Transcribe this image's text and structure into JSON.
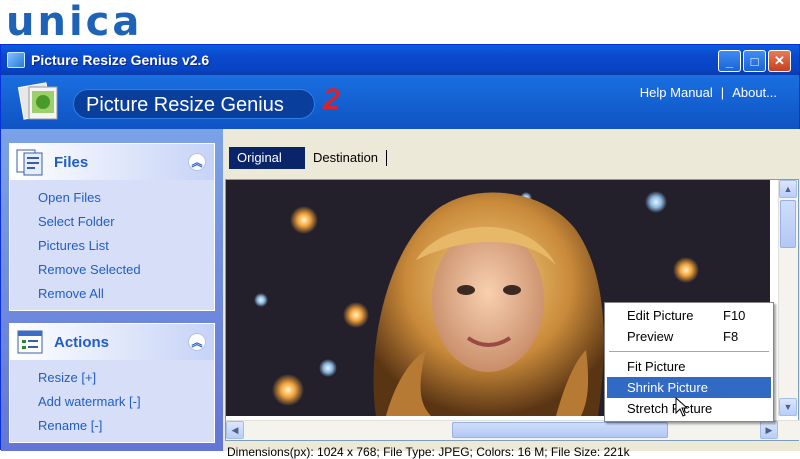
{
  "brand": "unica",
  "window": {
    "title": "Picture Resize Genius  v2.6",
    "buttons": {
      "minimize": "_",
      "maximize": "□",
      "close": "✕"
    }
  },
  "header": {
    "logo_text": "Picture Resize Genius",
    "logo_version": "2",
    "help_link": "Help Manual",
    "separator": "|",
    "about_link": "About..."
  },
  "sidebar": {
    "files": {
      "title": "Files",
      "items": [
        "Open Files",
        "Select Folder",
        "Pictures List",
        "Remove Selected",
        "Remove All"
      ]
    },
    "actions": {
      "title": "Actions",
      "items": [
        "Resize [+]",
        "Add watermark [-]",
        "Rename [-]"
      ]
    }
  },
  "tabs": {
    "original": "Original",
    "destination": "Destination"
  },
  "context_menu": {
    "edit_picture": {
      "label": "Edit Picture",
      "shortcut": "F10"
    },
    "preview": {
      "label": "Preview",
      "shortcut": "F8"
    },
    "fit_picture": "Fit Picture",
    "shrink_picture": "Shrink Picture",
    "stretch_picture": "Stretch Picture"
  },
  "status_text": "Dimensions(px): 1024 x 768; File Type: JPEG; Colors: 16 M; File Size: 221k",
  "colors": {
    "accent": "#215dc6",
    "title_bar": "#0a48cc",
    "highlight": "#316ac5"
  }
}
